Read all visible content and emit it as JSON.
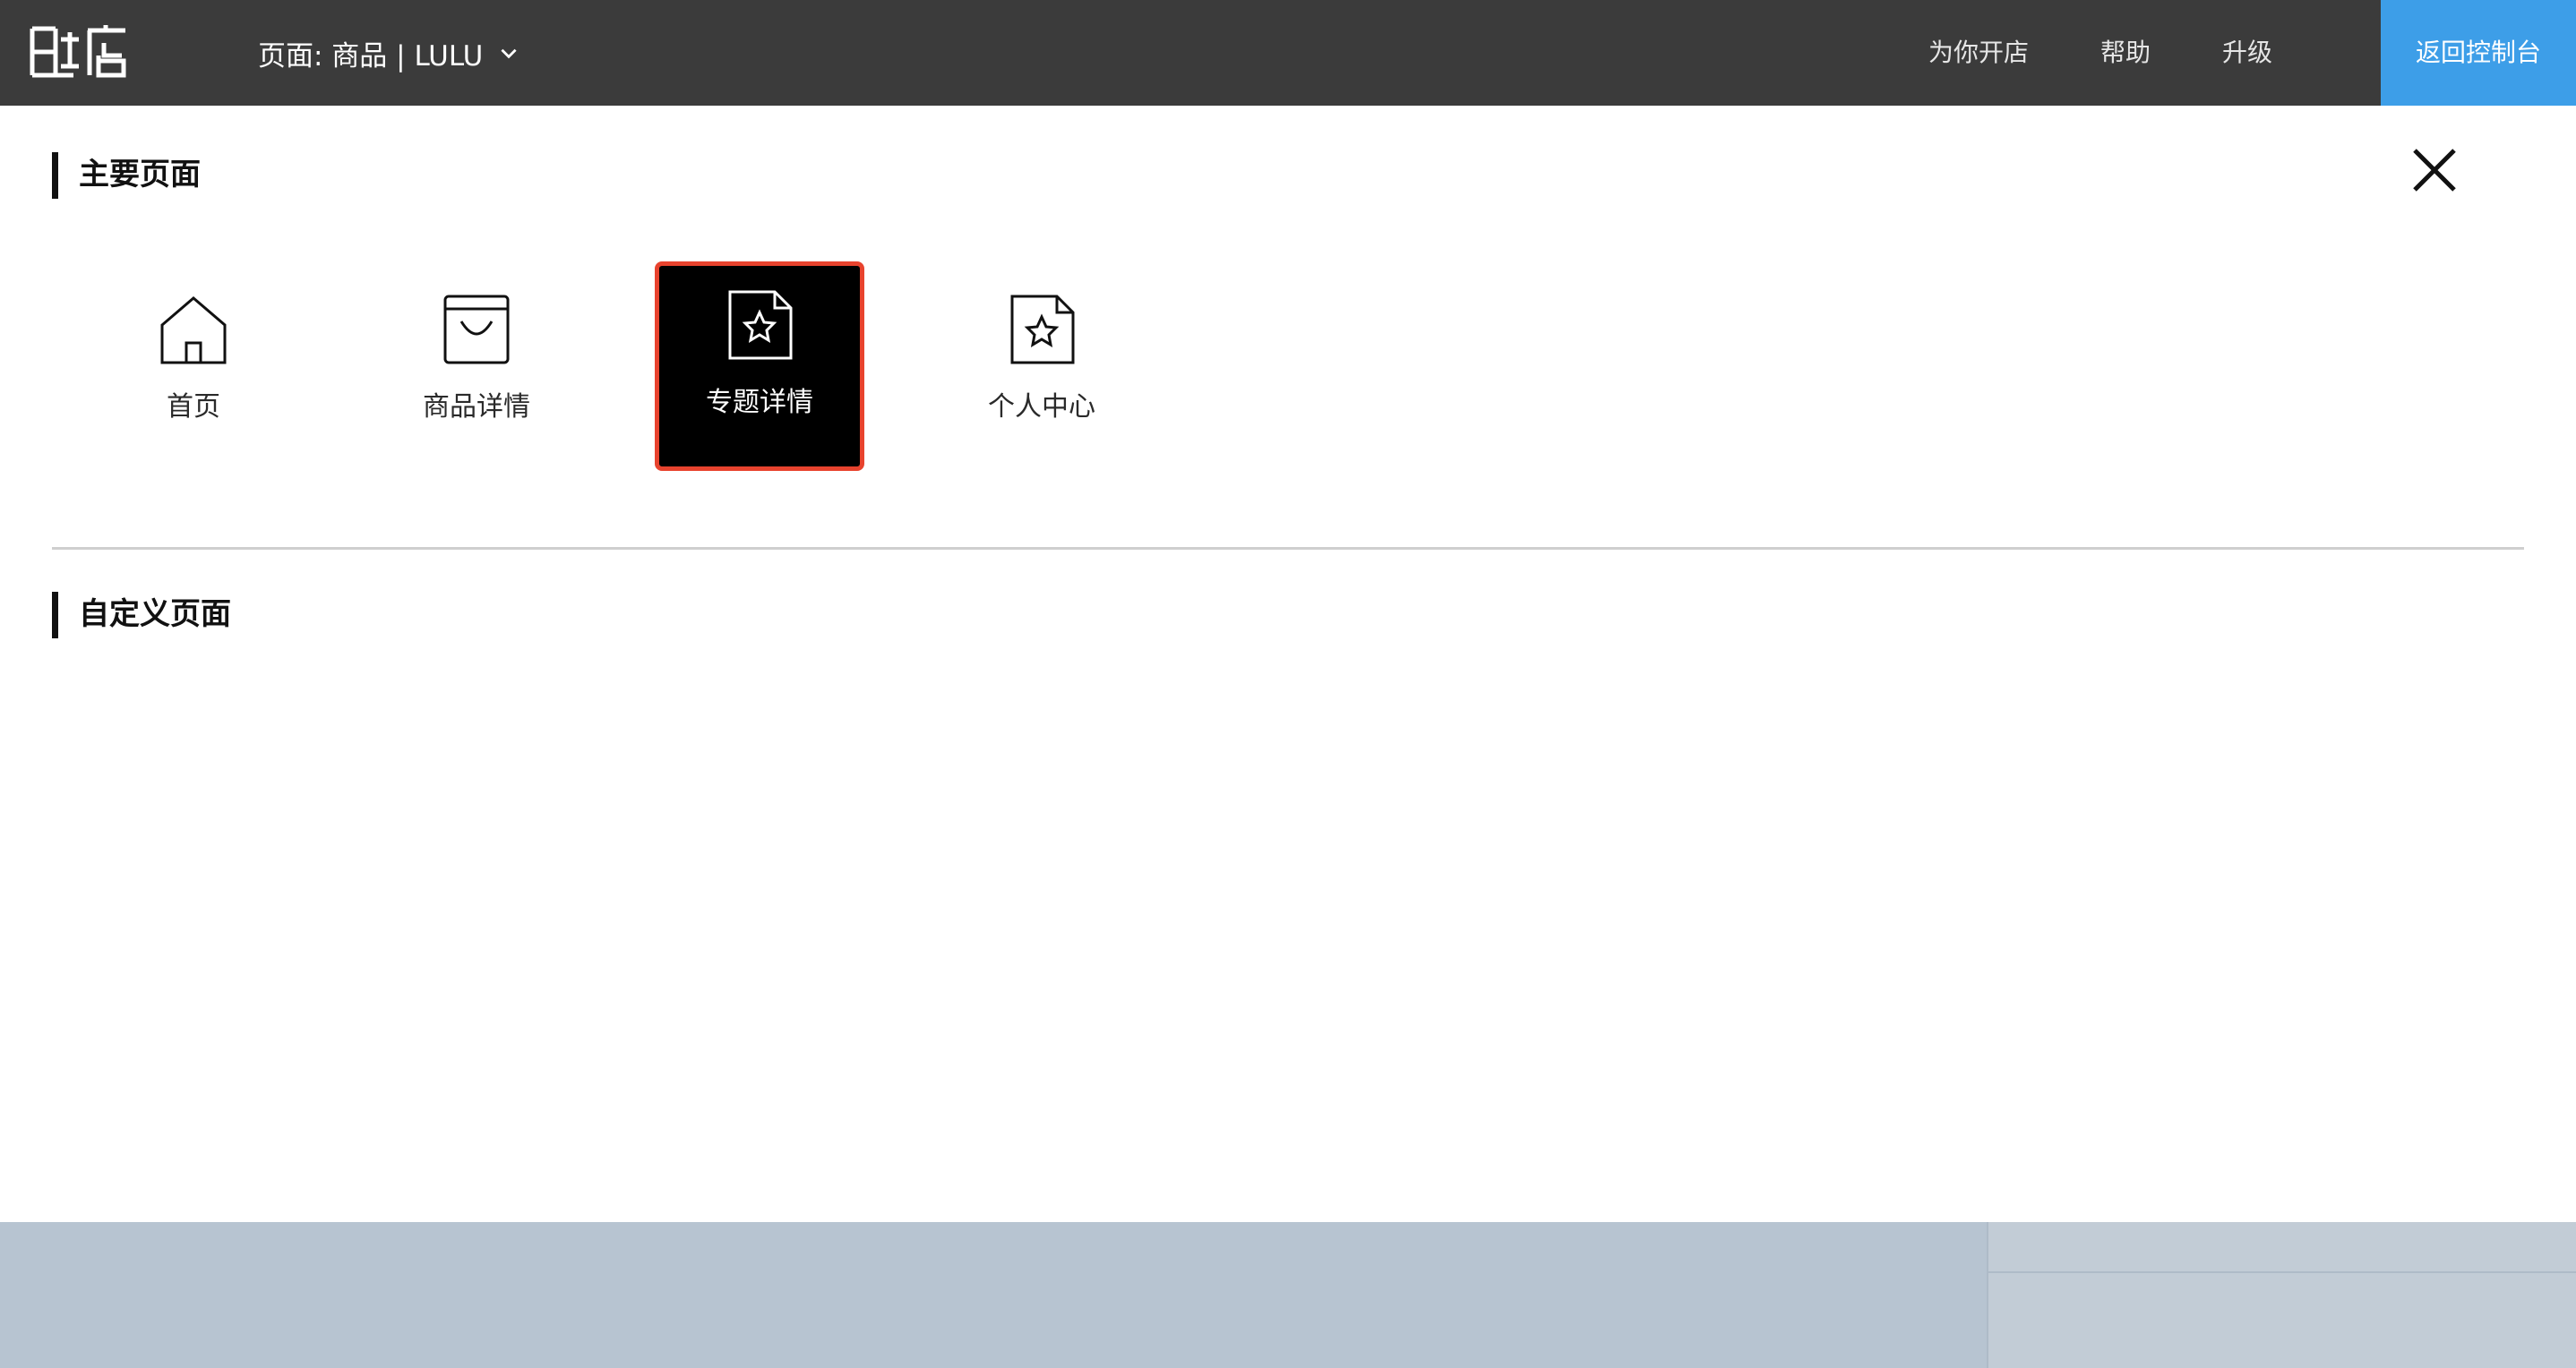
{
  "header": {
    "logo_text": "喔店",
    "page_selector": "页面: 商品 | LULU",
    "nav": {
      "open_store": "为你开店",
      "help": "帮助",
      "upgrade": "升级"
    },
    "console_button": "返回控制台"
  },
  "main_pages": {
    "title": "主要页面",
    "items": [
      {
        "label": "首页",
        "icon": "home-icon"
      },
      {
        "label": "商品详情",
        "icon": "shopping-bag-icon"
      },
      {
        "label": "专题详情",
        "icon": "star-document-icon",
        "selected": true
      },
      {
        "label": "个人中心",
        "icon": "star-document-icon"
      }
    ]
  },
  "custom_pages": {
    "title": "自定义页面"
  },
  "colors": {
    "topbar": "#3b3b3b",
    "accent": "#3d9ee8",
    "selected_border": "#e8432e",
    "selected_bg": "#000000",
    "bottom_bar": "#b7c4d1"
  }
}
